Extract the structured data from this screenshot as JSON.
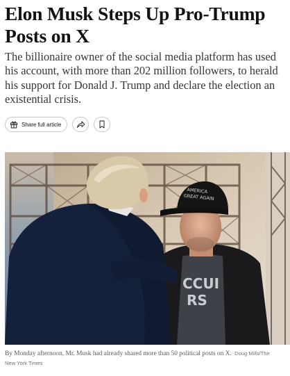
{
  "article": {
    "headline": "Elon Musk Steps Up Pro-Trump Posts on X",
    "summary": "The billionaire owner of the social media platform has used his account, with more than 202 million followers, to herald his support for Donald J. Trump and declare the election an existential crisis.",
    "toolbar": {
      "share_full_label": "Share full article",
      "share_full_icon": "gift-icon",
      "share_icon": "share-arrow-icon",
      "save_icon": "bookmark-icon"
    },
    "photo": {
      "hat_text_line1": "AMERICA",
      "hat_text_line2": "GREAT AGAIN",
      "shirt_text_line1": "CCUI",
      "shirt_text_line2": "RS"
    },
    "caption": {
      "text": "By Monday afternoon, Mr. Musk had already shared more than 50 political posts on X.",
      "credit": "Doug Mills/The New York Times"
    }
  }
}
